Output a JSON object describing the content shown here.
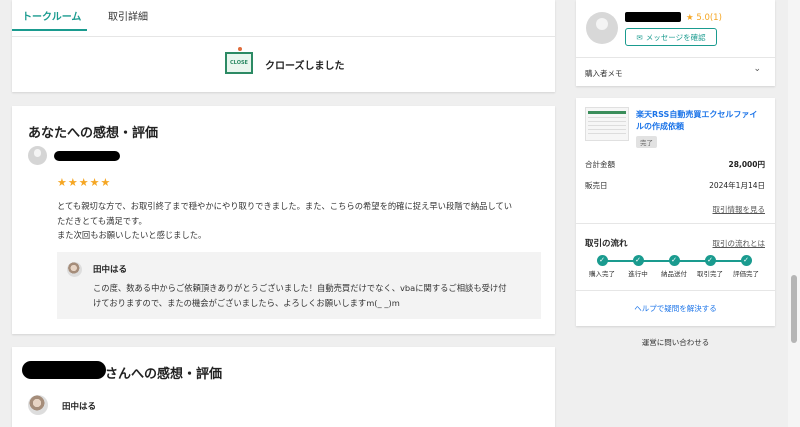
{
  "tabs": [
    {
      "label": "トークルーム",
      "active": true
    },
    {
      "label": "取引詳細",
      "active": false
    }
  ],
  "closed": {
    "sign_text": "CLOSE",
    "message": "クローズしました"
  },
  "review_for_you": {
    "heading": "あなたへの感想・評価",
    "stars": "★★★★★",
    "lines": [
      "とても親切な方で、お取引終了まで穏やかにやり取りできました。また、こちらの希望を的確に捉え早い段階で納品してい",
      "ただきとても満足です。",
      "また次回もお願いしたいと感じました。"
    ],
    "reply": {
      "name": "田中はる",
      "lines": [
        "この度、数ある中からご依頼頂きありがとうございました！自動売買だけでなく、vbaに関するご相談も受け付",
        "けておりますので、またの機会がございましたら、よろしくお願いしますm(_ _)m"
      ]
    }
  },
  "review_for_them": {
    "heading_suffix": "さんへの感想・評価",
    "name": "田中はる"
  },
  "sidebar": {
    "rating_star": "★",
    "rating_value": "5.0(1)",
    "message_button": "メッセージを確認",
    "buyer_memo": "購入者メモ",
    "order": {
      "title_lines": [
        "楽天RSS自動売買エクセルファイ",
        "ルの作成依頼"
      ],
      "status": "完了",
      "total_label": "合計金額",
      "total_value": "28,000円",
      "sale_date_label": "販売日",
      "sale_date_value": "2024年1月14日",
      "view_link": "取引情報を見る",
      "flow_title": "取引の流れ",
      "flow_link": "取引の流れとは",
      "steps": [
        "購入完了",
        "進行中",
        "納品送付",
        "取引完了",
        "評価完了"
      ],
      "help_link": "ヘルプで疑問を解決する"
    },
    "contact": "運営に問い合わせる"
  },
  "colors": {
    "accent": "#1a9b8f",
    "star": "#f5a623",
    "link": "#1a73e8"
  }
}
